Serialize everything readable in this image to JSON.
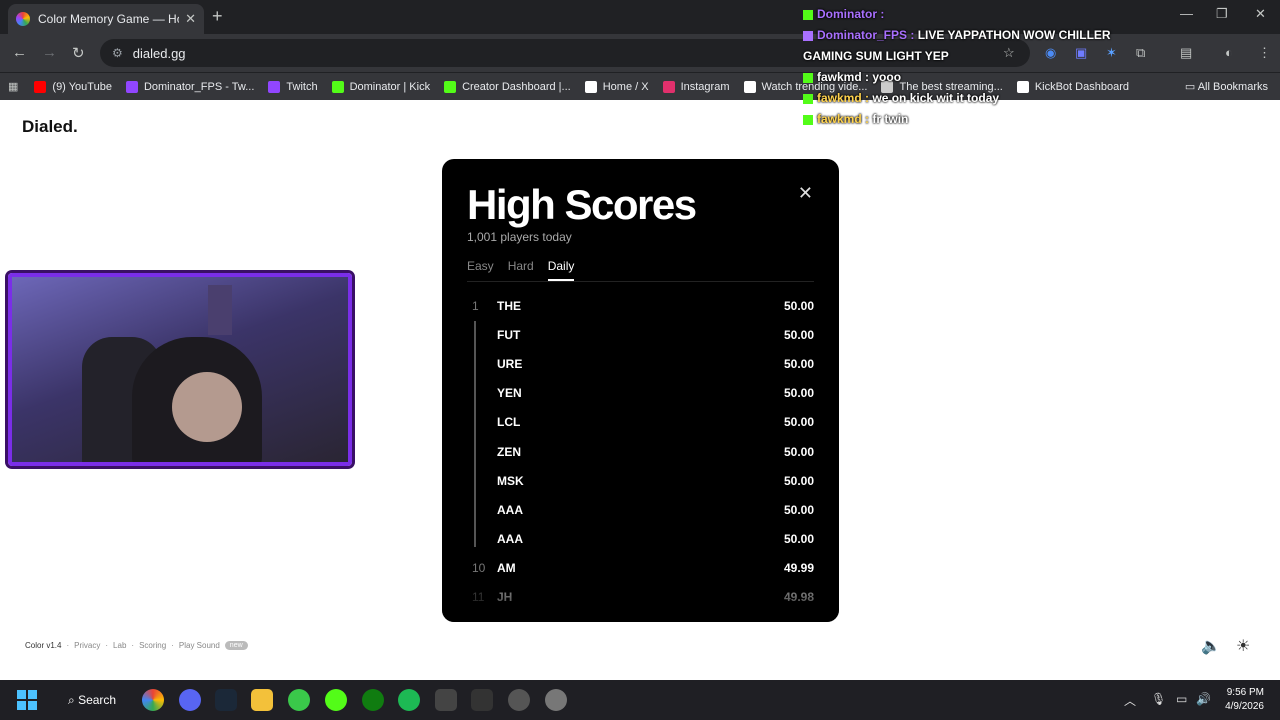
{
  "browser": {
    "tab_title": "Color Memory Game — How W",
    "url": "dialed.gg",
    "bookmarks": [
      {
        "label": "(9) YouTube",
        "color": "#ff0000"
      },
      {
        "label": "Dominator_FPS - Tw...",
        "color": "#9146ff"
      },
      {
        "label": "Twitch",
        "color": "#9146ff"
      },
      {
        "label": "Dominator | Kick",
        "color": "#53fc18"
      },
      {
        "label": "Creator Dashboard |...",
        "color": "#53fc18"
      },
      {
        "label": "Home / X",
        "color": "#ffffff"
      },
      {
        "label": "Instagram",
        "color": "#e1306c"
      },
      {
        "label": "Watch trending vide...",
        "color": "#ffffff"
      },
      {
        "label": "The best streaming...",
        "color": "#cccccc"
      },
      {
        "label": "KickBot Dashboard",
        "color": "#ffffff"
      }
    ],
    "all_bookmarks": "All Bookmarks"
  },
  "chat": {
    "line1_name": "Dominator :",
    "line2_name": "Dominator_FPS :",
    "line2_msg": "LIVE YAPPATHON WOW CHILLER",
    "line3_msg": "GAMING SUM LIGHT YEP",
    "line4_name": "fawkmd :",
    "line4_msg": "yooo",
    "line5_name": "fawkmd :",
    "line5_msg": "we on kick wit it today",
    "line6_name": "fawkmd :",
    "line6_msg": "fr twin"
  },
  "page": {
    "logo": "Dialed."
  },
  "modal": {
    "title": "High Scores",
    "subtitle": "1,001 players today",
    "tabs": [
      "Easy",
      "Hard",
      "Daily"
    ],
    "active_tab": "Daily",
    "rows": [
      {
        "rank": "1",
        "name": "THE",
        "score": "50.00"
      },
      {
        "rank": "",
        "name": "FUT",
        "score": "50.00"
      },
      {
        "rank": "",
        "name": "URE",
        "score": "50.00"
      },
      {
        "rank": "",
        "name": "YEN",
        "score": "50.00"
      },
      {
        "rank": "",
        "name": "LCL",
        "score": "50.00"
      },
      {
        "rank": "",
        "name": "ZEN",
        "score": "50.00"
      },
      {
        "rank": "",
        "name": "MSK",
        "score": "50.00"
      },
      {
        "rank": "",
        "name": "AAA",
        "score": "50.00"
      },
      {
        "rank": "",
        "name": "AAA",
        "score": "50.00"
      },
      {
        "rank": "10",
        "name": "AM",
        "score": "49.99"
      },
      {
        "rank": "11",
        "name": "JH",
        "score": "49.98"
      }
    ]
  },
  "footer": {
    "version": "Color v1.4",
    "links": [
      "Privacy",
      "Lab",
      "Scoring",
      "Play Sound"
    ],
    "new_badge": "new"
  },
  "taskbar": {
    "search": "Search",
    "time": "9:56 PM",
    "date": "4/9/2026"
  }
}
